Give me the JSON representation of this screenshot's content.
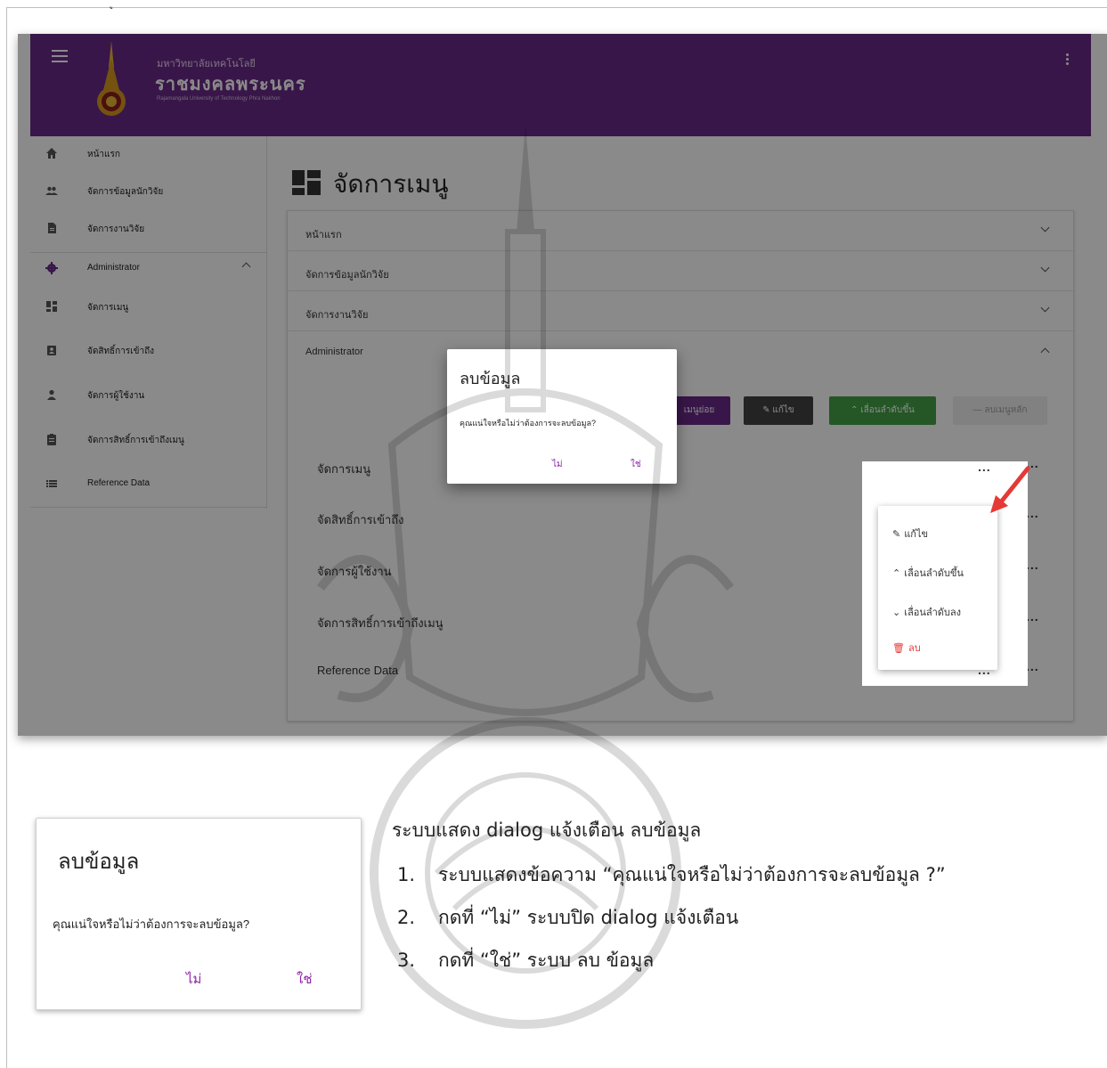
{
  "top_mark": "ู",
  "app": {
    "brand_small": "มหาวิทยาลัยเทคโนโลยี",
    "brand_big": "ราชมงคลพระนคร",
    "brand_tiny": "Rajamangala University of Technology Phra Nakhon"
  },
  "sidebar": {
    "items": [
      {
        "label": "หน้าแรก",
        "icon": "home-icon"
      },
      {
        "label": "จัดการข้อมูลนักวิจัย",
        "icon": "people-icon"
      },
      {
        "label": "จัดการงานวิจัย",
        "icon": "document-icon"
      },
      {
        "label": "Administrator",
        "icon": "gear-icon"
      },
      {
        "label": "จัดการเมนู",
        "icon": "dashboard-icon"
      },
      {
        "label": "จัดสิทธิ์การเข้าถึง",
        "icon": "badge-icon"
      },
      {
        "label": "จัดการผู้ใช้งาน",
        "icon": "person-icon"
      },
      {
        "label": "จัดการสิทธิ์การเข้าถึงเมนู",
        "icon": "clipboard-icon"
      },
      {
        "label": "Reference Data",
        "icon": "list-icon"
      }
    ]
  },
  "page": {
    "title": "จัดการเมนู"
  },
  "panel": {
    "rows": [
      {
        "label": "หน้าแรก"
      },
      {
        "label": "จัดการข้อมูลนักวิจัย"
      },
      {
        "label": "จัดการงานวิจัย"
      },
      {
        "label": "Administrator"
      }
    ],
    "buttons": {
      "add_sub": "เมนูย่อย",
      "edit": "แก้ไข",
      "move_up": "เลื่อนลำดับขึ้น",
      "remove_main": "ลบเมนูหลัก"
    },
    "sub_items": [
      {
        "label": "จัดการเมนู"
      },
      {
        "label": "จัดสิทธิ์การเข้าถึง"
      },
      {
        "label": "จัดการผู้ใช้งาน"
      },
      {
        "label": "จัดการสิทธิ์การเข้าถึงเมนู"
      },
      {
        "label": "Reference Data"
      }
    ],
    "dots": "..."
  },
  "context_menu": {
    "edit": "แก้ไข",
    "move_up": "เลื่อนลำดับขึ้น",
    "move_down": "เลื่อนลำดับลง",
    "delete": "ลบ"
  },
  "dialog": {
    "title": "ลบข้อมูล",
    "message": "คุณแน่ใจหรือไม่ว่าต้องการจะลบข้อมูล?",
    "no": "ไม่",
    "yes": "ใช่"
  },
  "description": {
    "intro": "ระบบแสดง dialog แจ้งเตือน ลบข้อมูล",
    "steps": [
      {
        "num": "1.",
        "text": "ระบบแสดงข้อความ “คุณแน่ใจหรือไม่ว่าต้องการจะลบข้อมูล ?”"
      },
      {
        "num": "2.",
        "text": "กดที่ “ไม่” ระบบปิด dialog แจ้งเตือน"
      },
      {
        "num": "3.",
        "text": "กดที่ “ใช่” ระบบ ลบ ข้อมูล"
      }
    ]
  },
  "colors": {
    "appbar": "#6a2a87",
    "accent": "#8e24aa",
    "green": "#43a047",
    "dark_button": "#424242",
    "delete_red": "#e53935"
  }
}
